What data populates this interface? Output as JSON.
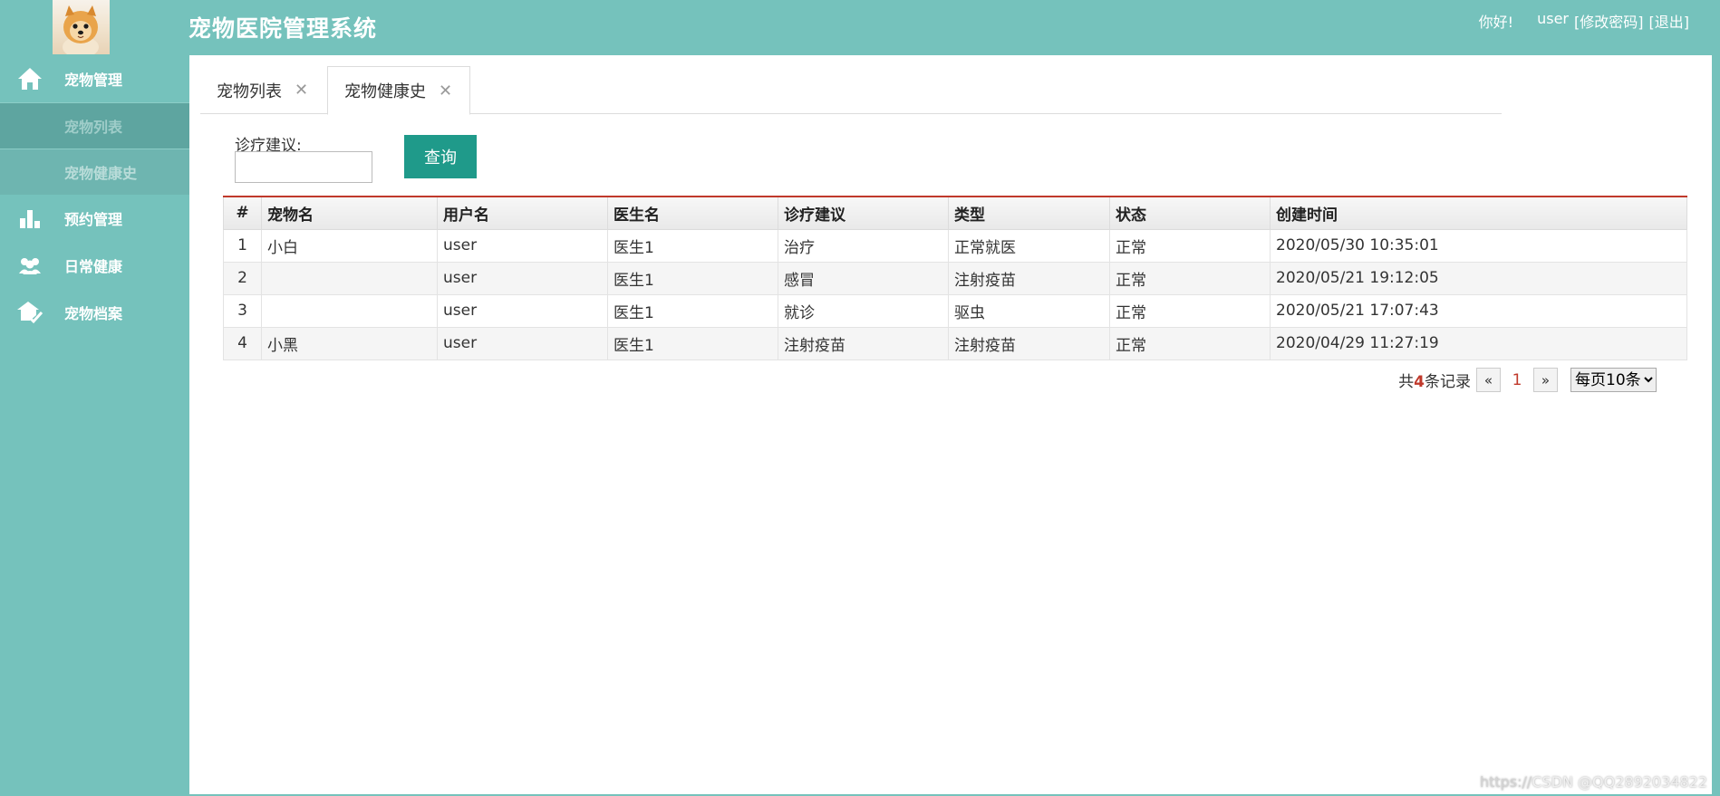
{
  "header": {
    "title": "宠物医院管理系统",
    "greeting": "你好!",
    "username": "user",
    "change_password": "[修改密码]",
    "logout": "[退出]"
  },
  "sidebar": {
    "items": [
      {
        "label": "宠物管理",
        "icon": "home-icon"
      },
      {
        "label": "宠物列表"
      },
      {
        "label": "宠物健康史"
      },
      {
        "label": "预约管理",
        "icon": "bar-chart-icon"
      },
      {
        "label": "日常健康",
        "icon": "users-icon"
      },
      {
        "label": "宠物档案",
        "icon": "house-check-icon"
      }
    ]
  },
  "tabs": [
    {
      "label": "宠物列表"
    },
    {
      "label": "宠物健康史",
      "active": true
    }
  ],
  "search": {
    "label": "诊疗建议:",
    "value": "",
    "button": "查询"
  },
  "table": {
    "columns": [
      "#",
      "宠物名",
      "用户名",
      "医生名",
      "诊疗建议",
      "类型",
      "状态",
      "创建时间"
    ],
    "rows": [
      [
        "1",
        "小白",
        "user",
        "医生1",
        "治疗",
        "正常就医",
        "正常",
        "2020/05/30 10:35:01"
      ],
      [
        "2",
        "",
        "user",
        "医生1",
        "感冒",
        "注射疫苗",
        "正常",
        "2020/05/21 19:12:05"
      ],
      [
        "3",
        "",
        "user",
        "医生1",
        "就诊",
        "驱虫",
        "正常",
        "2020/05/21 17:07:43"
      ],
      [
        "4",
        "小黑",
        "user",
        "医生1",
        "注射疫苗",
        "注射疫苗",
        "正常",
        "2020/04/29 11:27:19"
      ]
    ]
  },
  "pager": {
    "prefix": "共",
    "total": "4",
    "suffix": "条记录",
    "prev": "«",
    "current_page": "1",
    "next": "»",
    "page_size": "每页10条"
  },
  "watermark": {
    "faint": "https://",
    "text": "CSDN @QQ2892034822"
  },
  "colors": {
    "theme": "#75c2bc",
    "button": "#1f9a8a",
    "accent_red": "#c0392b"
  }
}
